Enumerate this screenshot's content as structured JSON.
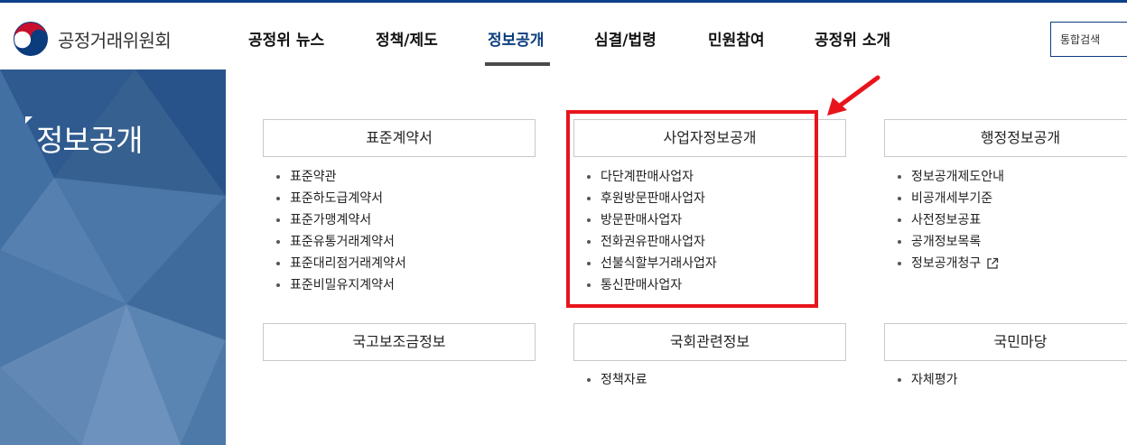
{
  "header": {
    "logo_text": "공정거래위원회",
    "nav": [
      "공정위 뉴스",
      "정책/제도",
      "정보공개",
      "심결/법령",
      "민원참여",
      "공정위 소개"
    ],
    "active_nav": "정보공개",
    "search_placeholder": "통합검색"
  },
  "side": {
    "title": "정보공개"
  },
  "sections": [
    {
      "title": "표준계약서",
      "items": [
        "표준약관",
        "표준하도급계약서",
        "표준가맹계약서",
        "표준유통거래계약서",
        "표준대리점거래계약서",
        "표준비밀유지계약서"
      ]
    },
    {
      "title": "사업자정보공개",
      "items": [
        "다단계판매사업자",
        "후원방문판매사업자",
        "방문판매사업자",
        "전화권유판매사업자",
        "선불식할부거래사업자",
        "통신판매사업자"
      ]
    },
    {
      "title": "행정정보공개",
      "items": [
        "정보공개제도안내",
        "비공개세부기준",
        "사전정보공표",
        "공개정보목록",
        "정보공개청구"
      ]
    },
    {
      "title": "국고보조금정보",
      "items": []
    },
    {
      "title": "국회관련정보",
      "items": [
        "정책자료"
      ]
    },
    {
      "title": "국민마당",
      "items": [
        "자체평가"
      ]
    }
  ],
  "colors": {
    "brand_navy": "#0b3c7d",
    "highlight_red": "#e8141c"
  }
}
